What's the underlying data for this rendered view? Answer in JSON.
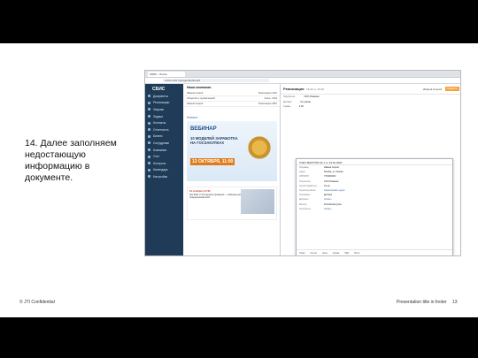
{
  "slide": {
    "step_text": "14. Далее заполняем недостающую информацию в документе.",
    "footer_left": "© JTI Confidential",
    "footer_right": "Presentation title in footer",
    "page_number": "13"
  },
  "screenshot": {
    "browser_tab": "СБИС - Лента",
    "address": "online.sbis.ru/page/dashboard",
    "sidebar": {
      "logo": "СБИС",
      "items": [
        {
          "label": "Документы"
        },
        {
          "label": "Реализации"
        },
        {
          "label": "Закупки"
        },
        {
          "label": "Задачи"
        },
        {
          "label": "Контакты"
        },
        {
          "label": "Отчетность"
        },
        {
          "label": "Бизнес"
        },
        {
          "label": "Сотрудники"
        },
        {
          "label": "Компании"
        },
        {
          "label": "Учет"
        },
        {
          "label": "Контроль"
        },
        {
          "label": "Календарь"
        },
        {
          "label": "Настройки"
        }
      ]
    },
    "feed": {
      "title": "Наши компании",
      "rows": [
        {
          "name": "Иванов Сергей",
          "a": "Реализация",
          "b": "1321"
        },
        {
          "name": "Общество с ограниченной",
          "a": "Контр.",
          "b": "1234"
        },
        {
          "name": "Иванов Сергей",
          "a": "Реализация",
          "b": "4451"
        }
      ],
      "news_title": "Новости",
      "webinar": {
        "label": "ВЕБИНАР",
        "subtitle": "10 МОДЕЛЕЙ ЗАРАБОТКА НА ГОСЗАКУПКАХ",
        "date": "13 ОКТЯБРЯ, 11:00"
      },
      "card2_date": "19 октября в 12:00",
      "card2_text": "Как ФНС и ЧЗ сделали проверки — вебинар для предпринимателей"
    },
    "document": {
      "title": "Реализация",
      "number": "№ 42 от 13.10",
      "user": "Иванов Сергей",
      "button": "Провести",
      "fields": [
        {
          "k": "Покупатель",
          "v": "ООО Ромашка"
        },
        {
          "k": "Договор",
          "v": "Не указан"
        },
        {
          "k": "Сумма",
          "v": "0.00"
        }
      ]
    },
    "popup": {
      "head": "СЧЕТ-ФАКТУРА № 1 от 13.10.2021",
      "rows": [
        {
          "k": "Продавец",
          "v": "Иванов Сергей"
        },
        {
          "k": "Адрес",
          "v": "Москва, ул. Ленина"
        },
        {
          "k": "ИНН/КПП",
          "v": "7700000000"
        },
        {
          "k": "Покупатель",
          "v": "ООО Ромашка"
        },
        {
          "k": "Грузоотправитель",
          "v": "Он же"
        },
        {
          "k": "Грузополучатель",
          "v": "Редактировать адрес"
        },
        {
          "k": "Основание",
          "v": "Договор"
        },
        {
          "k": "Документ",
          "v": "Указать"
        },
        {
          "k": "Валюта",
          "v": "Российский рубль"
        },
        {
          "k": "Получатель",
          "v": "Указать"
        }
      ],
      "bottom": [
        "Товар",
        "Кол-во",
        "Цена",
        "Сумма",
        "НДС",
        "Всего"
      ]
    }
  }
}
